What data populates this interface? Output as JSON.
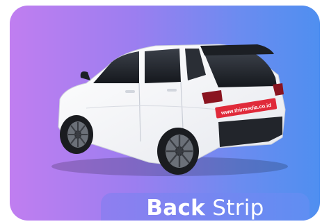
{
  "card": {
    "caption_bold": "Back",
    "caption_rest": "Strip"
  },
  "car": {
    "strip_text": "www.thirmedia.co.id"
  },
  "colors": {
    "gradient_start": "#c07ef0",
    "gradient_end": "#4f8ff0",
    "car_body": "#ffffff",
    "strip": "#e02a3a"
  }
}
